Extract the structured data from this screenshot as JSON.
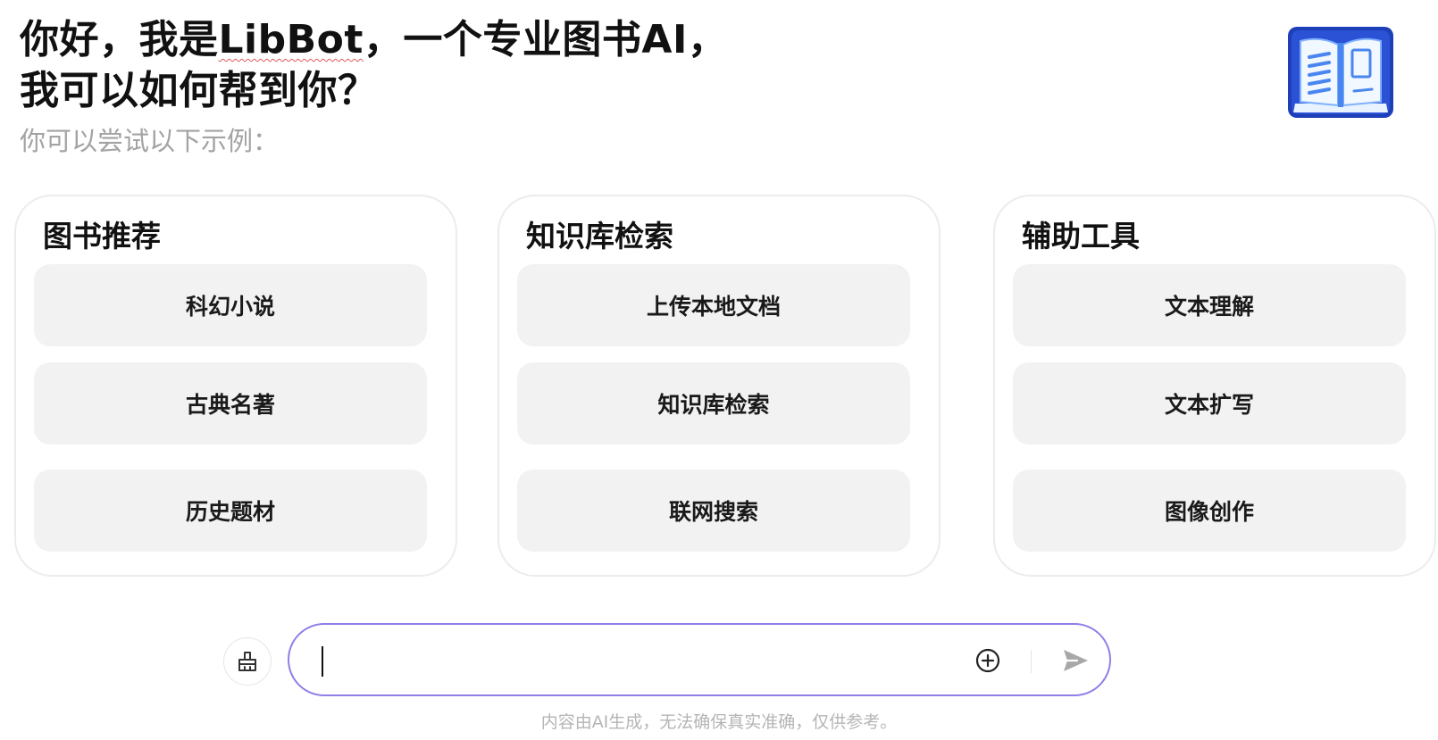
{
  "header": {
    "line1_prefix": "你好，我是",
    "brand": "LibBot",
    "line1_suffix": "，一个专业图书AI，",
    "line2": "我可以如何帮到你？",
    "subtitle": "你可以尝试以下示例："
  },
  "logo": {
    "icon": "open-book-icon",
    "colors": [
      "#1d3fb8",
      "#4a86f0",
      "#eaf3ff"
    ]
  },
  "cards": [
    {
      "title": "图书推荐",
      "items": [
        "科幻小说",
        "古典名著",
        "历史题材"
      ]
    },
    {
      "title": "知识库检索",
      "items": [
        "上传本地文档",
        "知识库检索",
        "联网搜索"
      ]
    },
    {
      "title": "辅助工具",
      "items": [
        "文本理解",
        "文本扩写",
        "图像创作"
      ]
    }
  ],
  "composer": {
    "input_value": "",
    "side_icon": "brush-icon",
    "add_icon": "plus-circle-icon",
    "send_icon": "send-icon",
    "accent": "#8f7fe8"
  },
  "footer": {
    "note": "内容由AI生成，无法确保真实准确，仅供参考。"
  }
}
